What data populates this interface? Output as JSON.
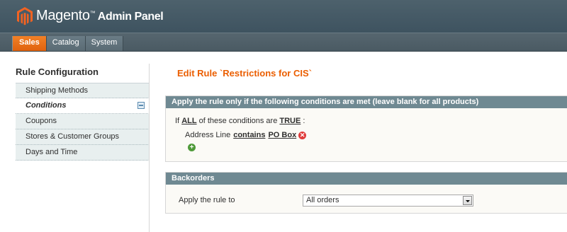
{
  "header": {
    "brand_name": "Magento",
    "brand_tm": "™",
    "brand_sub": "Admin Panel",
    "logo_icon": "magento-logo-icon",
    "accent": "#eb5e00"
  },
  "nav": {
    "tabs": [
      {
        "label": "Sales",
        "active": true
      },
      {
        "label": "Catalog",
        "active": false
      },
      {
        "label": "System",
        "active": false
      }
    ]
  },
  "sidebar": {
    "title": "Rule Configuration",
    "items": [
      {
        "label": "Shipping Methods",
        "active": false
      },
      {
        "label": "Conditions",
        "active": true
      },
      {
        "label": "Coupons",
        "active": false
      },
      {
        "label": "Stores & Customer Groups",
        "active": false
      },
      {
        "label": "Days and Time",
        "active": false
      }
    ]
  },
  "main": {
    "page_title": "Edit Rule `Restrictions for CIS`",
    "conditions": {
      "header": "Apply the rule only if the following conditions are met (leave blank for all products)",
      "if_text": "If",
      "aggregator": "ALL",
      "middle_text": "of these conditions are",
      "value": "TRUE",
      "colon": ":",
      "child": {
        "attribute": "Address Line",
        "operator": "contains",
        "value": "PO Box"
      }
    },
    "backorders": {
      "header": "Backorders",
      "label": "Apply the rule to",
      "selected": "All orders"
    }
  }
}
